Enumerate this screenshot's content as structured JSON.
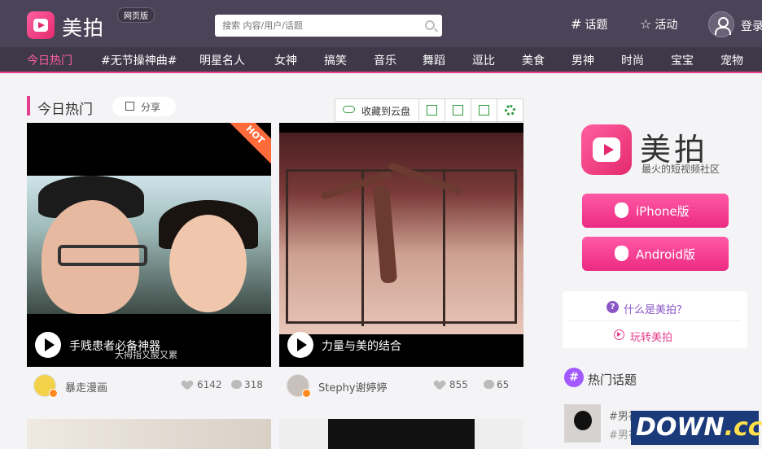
{
  "header": {
    "brand": "美拍",
    "web_badge": "网页版",
    "search_placeholder": "搜索 内容/用户/话题",
    "topics_link": "话题",
    "activities_link": "活动",
    "login": "登录"
  },
  "nav": {
    "items": [
      "今日热门",
      "#无节操神曲#",
      "明星名人",
      "女神",
      "搞笑",
      "音乐",
      "舞蹈",
      "逗比",
      "美食",
      "男神",
      "时尚",
      "宝宝",
      "宠物"
    ],
    "active_index": 0
  },
  "section": {
    "title": "今日热门",
    "share_label": "分享"
  },
  "toolbar": {
    "cloud_label": "收藏到云盘",
    "icons": [
      "expand-icon",
      "save-icon",
      "export-icon",
      "gear-icon"
    ]
  },
  "videos": [
    {
      "title": "手贱患者必备神器",
      "badge": "HOT",
      "subtitle_overlay": "大拇指又酸又累",
      "author": "暴走漫画",
      "likes": "6142",
      "comments": "318"
    },
    {
      "title": "力量与美的结合",
      "author": "Stephy谢婷婷",
      "likes": "855",
      "comments": "65"
    }
  ],
  "sidebar": {
    "brand": "美拍",
    "slogan": "最火的短视频社区",
    "iphone_label": "iPhone版",
    "android_label": "Android版",
    "faq_what": "什么是美拍？",
    "faq_howto": "玩转美拍",
    "topics_title": "热门话题",
    "topic_lines": [
      "#男神",
      "#男神"
    ]
  },
  "watermark": {
    "left": "DOWN",
    "right": ".cc"
  },
  "colors": {
    "header_bg": "#4b4458",
    "nav_bg": "#3e3849",
    "accent": "#e43f8c",
    "faq_purple": "#8a56c8",
    "topics_purple": "#a259ff",
    "icon_green": "#2e9a3e"
  }
}
